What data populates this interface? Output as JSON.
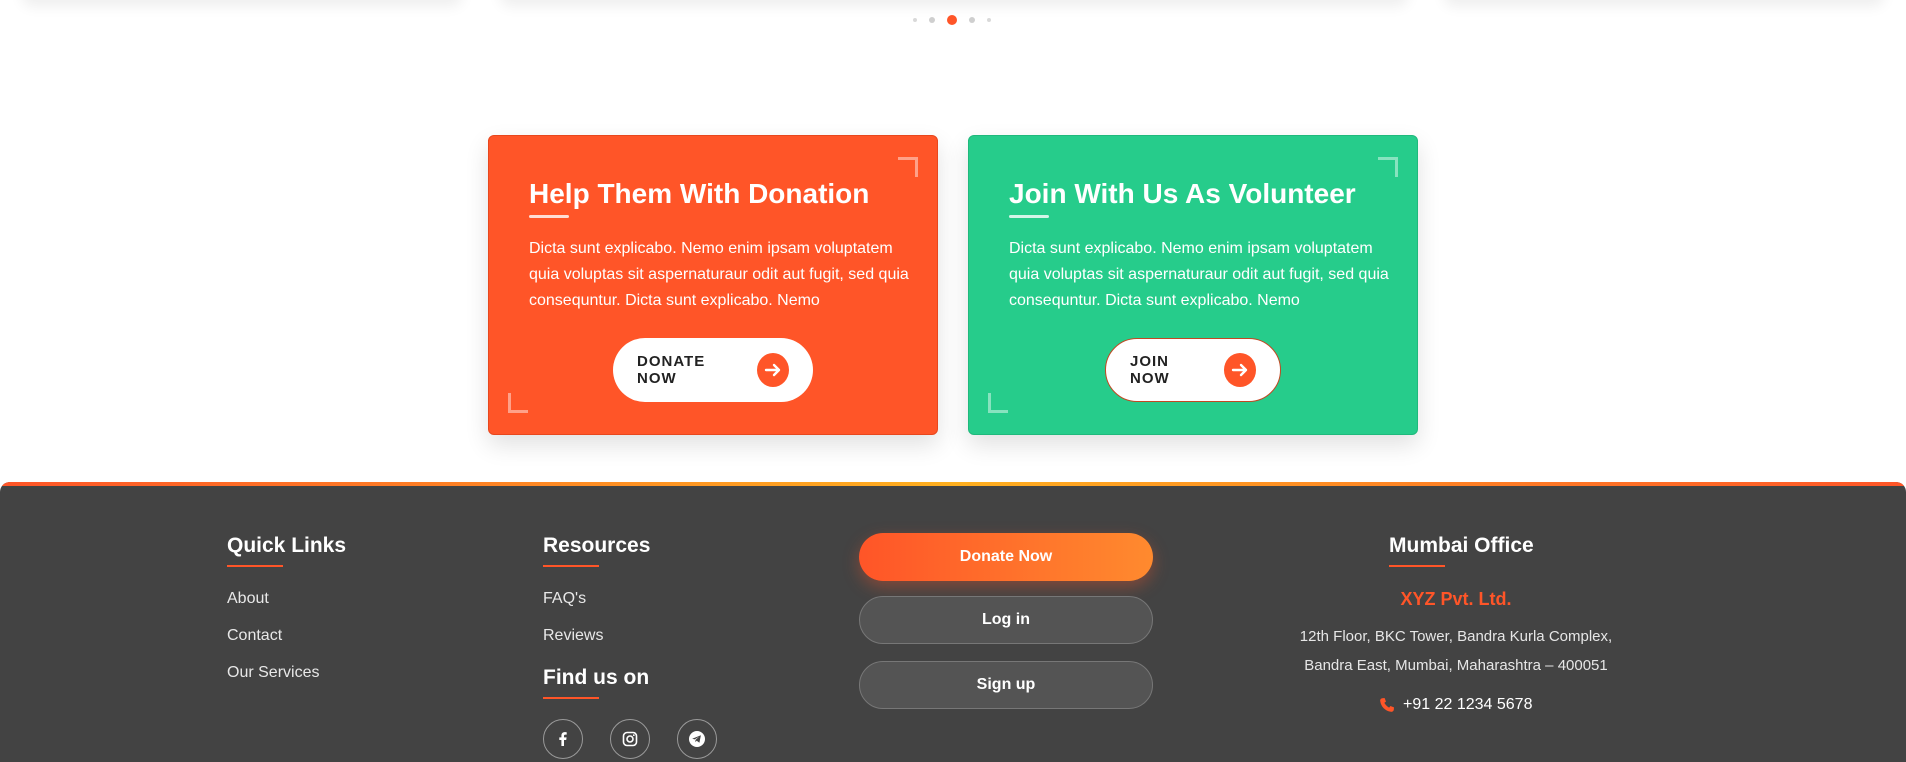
{
  "carousel": {
    "dots": 5,
    "active_dot": 3
  },
  "cta_cards": [
    {
      "title": "Help Them With Donation",
      "text": "Dicta sunt explicabo. Nemo enim ipsam voluptatem quia voluptas sit aspernaturaur odit aut fugit, sed quia consequntur. Dicta sunt explicabo. Nemo",
      "button": "DONATE NOW",
      "color": "#ff5528"
    },
    {
      "title": "Join With Us As Volunteer",
      "text": "Dicta sunt explicabo. Nemo enim ipsam voluptatem quia voluptas sit aspernaturaur odit aut fugit, sed quia consequntur. Dicta sunt explicabo. Nemo",
      "button": "JOIN NOW",
      "color": "#26cc8b"
    }
  ],
  "footer": {
    "quick_links": {
      "title": "Quick Links",
      "items": [
        "About",
        "Contact",
        "Our Services"
      ]
    },
    "resources": {
      "title": "Resources",
      "items": [
        "FAQ's",
        "Reviews"
      ]
    },
    "find_us": {
      "title": "Find us on",
      "icons": [
        "facebook-icon",
        "instagram-icon",
        "telegram-icon"
      ]
    },
    "actions": {
      "donate": "Donate Now",
      "login": "Log in",
      "signup": "Sign up"
    },
    "office": {
      "title": "Mumbai Office",
      "company": "XYZ Pvt. Ltd.",
      "address_line1": "12th Floor, BKC Tower, Bandra Kurla Complex,",
      "address_line2": "Bandra East, Mumbai, Maharashtra – 400051",
      "phone": "+91 22 1234 5678"
    },
    "accent": "#ff5528",
    "background": "#434343"
  }
}
